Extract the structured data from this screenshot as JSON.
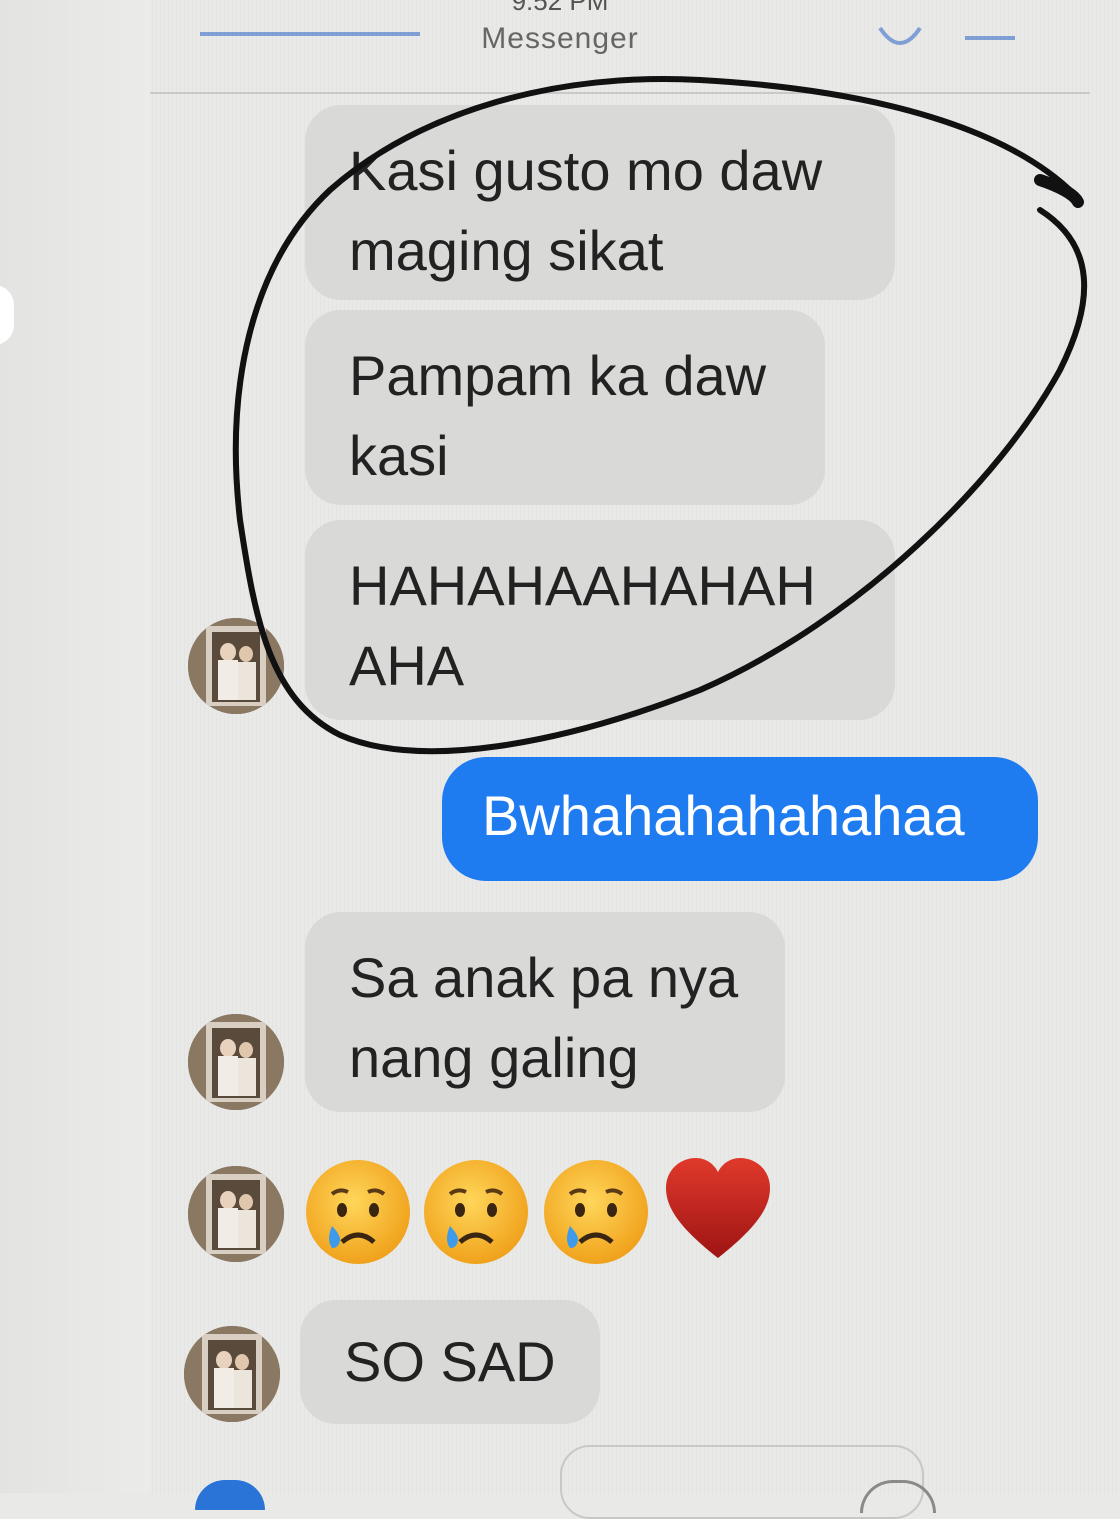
{
  "status_bar": {
    "time": "9:52 PM"
  },
  "header": {
    "title": "Messenger"
  },
  "messages": [
    {
      "direction": "incoming",
      "lines": [
        "Kasi gusto mo daw",
        "maging sikat"
      ]
    },
    {
      "direction": "incoming",
      "lines": [
        "Pampam ka daw",
        "kasi"
      ]
    },
    {
      "direction": "incoming",
      "lines": [
        "HAHAHAAHAHAH",
        "AHA"
      ]
    },
    {
      "direction": "outgoing",
      "lines": [
        "Bwhahahahahahaa"
      ]
    },
    {
      "direction": "incoming",
      "lines": [
        "Sa anak pa nya",
        "nang galing"
      ]
    },
    {
      "direction": "incoming",
      "emojis": [
        "crying-face-icon",
        "crying-face-icon",
        "crying-face-icon",
        "red-heart-icon"
      ]
    },
    {
      "direction": "incoming",
      "lines": [
        "SO SAD"
      ]
    }
  ],
  "colors": {
    "outgoing_bubble": "#1f7cf0",
    "incoming_bubble": "#d9d9d7",
    "annotation": "#111111"
  }
}
